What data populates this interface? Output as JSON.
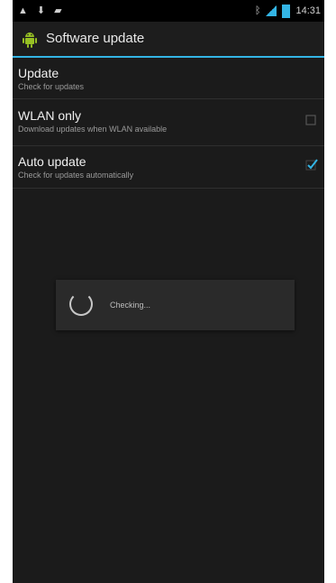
{
  "status_bar": {
    "notification_icons": [
      "warning-icon",
      "download-icon",
      "usb-icon"
    ],
    "time": "14:31"
  },
  "action_bar": {
    "title": "Software update",
    "icon": "android-icon"
  },
  "preferences": [
    {
      "title": "Update",
      "summary": "Check for updates"
    },
    {
      "title": "WLAN only",
      "summary": "Download updates when WLAN available",
      "checked": false
    },
    {
      "title": "Auto update",
      "summary": "Check for updates automatically",
      "checked": true
    }
  ],
  "dialog": {
    "message": "Checking..."
  },
  "colors": {
    "accent": "#33b5e5",
    "background": "#1b1b1b"
  }
}
